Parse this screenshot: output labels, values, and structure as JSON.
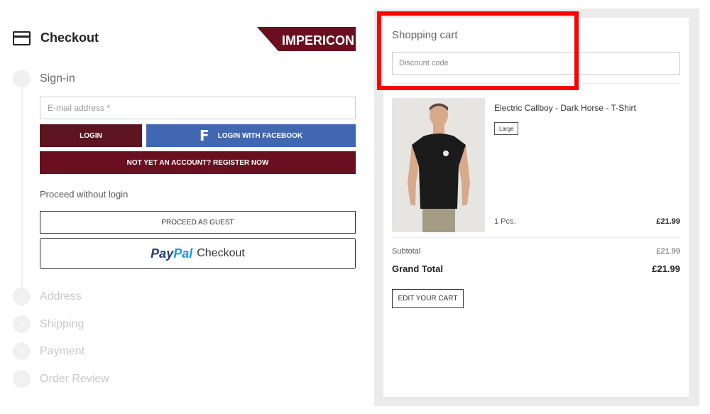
{
  "header": {
    "title": "Checkout",
    "brand": "IMPERICON",
    "icon": "credit-card-icon"
  },
  "steps": [
    {
      "number": "1",
      "label": "Sign-in",
      "active": true
    },
    {
      "number": "2",
      "label": "Address",
      "active": false
    },
    {
      "number": "3",
      "label": "Shipping",
      "active": false
    },
    {
      "number": "4",
      "label": "Payment",
      "active": false
    },
    {
      "number": "5",
      "label": "Order Review",
      "active": false
    }
  ],
  "login": {
    "email_placeholder": "E-mail address *",
    "login_label": "LOGIN",
    "facebook_label": "LOGIN WITH FACEBOOK",
    "register_label": "NOT YET AN ACCOUNT? REGISTER NOW",
    "proceed_text": "Proceed without login",
    "guest_label": "PROCEED AS GUEST",
    "paypal_brand_a": "Pay",
    "paypal_brand_b": "Pal",
    "paypal_checkout": "Checkout"
  },
  "cart": {
    "title": "Shopping cart",
    "discount_placeholder": "Discount code",
    "item": {
      "name": "Electric Callboy - Dark Horse - T-Shirt",
      "size": "Large",
      "quantity": "1 Pcs.",
      "price": "£21.99"
    },
    "subtotal_label": "Subtotal",
    "subtotal_value": "£21.99",
    "grand_total_label": "Grand Total",
    "grand_total_value": "£21.99",
    "edit_label": "EDIT YOUR CART"
  },
  "colors": {
    "brand_red": "#6a0f1f",
    "facebook_blue": "#4267b2",
    "highlight": "#ff0000"
  }
}
